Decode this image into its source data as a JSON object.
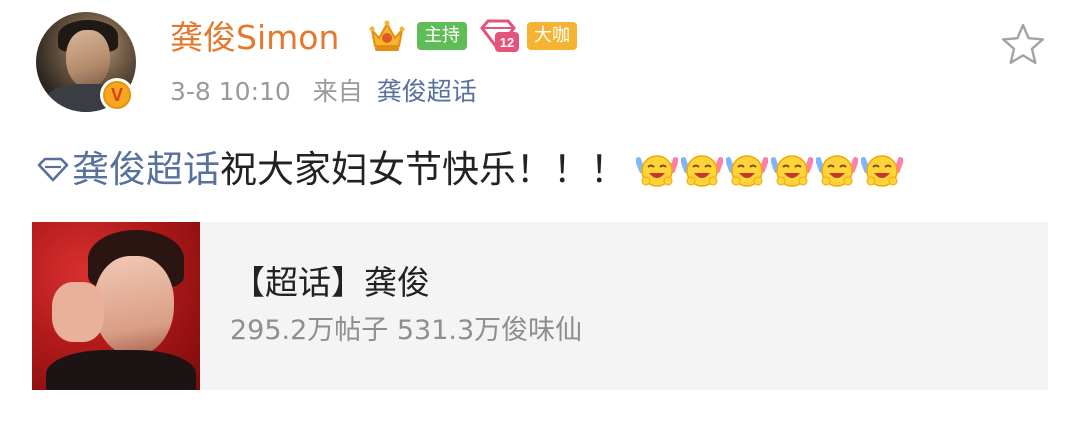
{
  "post": {
    "author": {
      "name": "龚俊Simon",
      "badges": {
        "host": "主持",
        "level": "12",
        "vip": "大咖"
      },
      "verified_mark": "V"
    },
    "meta": {
      "time": "3-8 10:10",
      "from_label": "来自",
      "source": "龚俊超话"
    },
    "content": {
      "topic": "龚俊超话",
      "text": " 祝大家妇女节快乐！！！",
      "emoji_count": 6,
      "emoji_name": "laughing-cheer-emoji"
    },
    "card": {
      "title": "【超话】龚俊",
      "subtitle": "295.2万帖子 531.3万俊味仙"
    }
  },
  "icons": {
    "crown": "crown-icon",
    "star": "star-outline-icon",
    "diamond": "supertopic-diamond-icon"
  },
  "colors": {
    "name": "#e5782d",
    "link": "#58709c",
    "host_badge": "#5fbd58",
    "vip_badge": "#f4b330"
  }
}
